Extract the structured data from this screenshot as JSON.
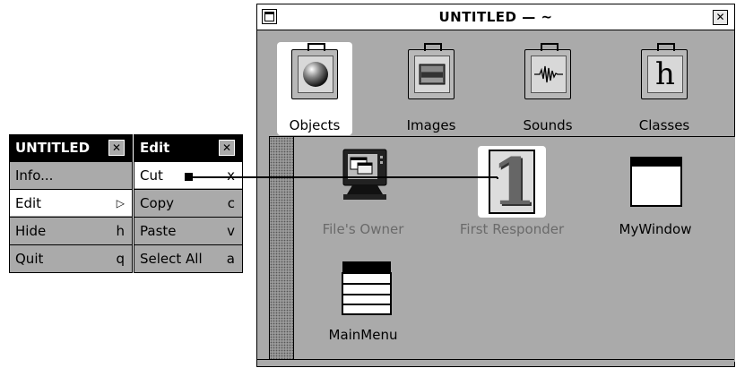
{
  "window": {
    "title": "UNTITLED — ~",
    "close_glyph": "✕",
    "suitcases": [
      {
        "label": "Objects",
        "icon": "sphere-icon",
        "selected": true
      },
      {
        "label": "Images",
        "icon": "image-icon",
        "selected": false
      },
      {
        "label": "Sounds",
        "icon": "waveform-icon",
        "selected": false
      },
      {
        "label": "Classes",
        "icon": "h-letter-icon",
        "glyph": "h",
        "selected": false
      }
    ],
    "objects": [
      {
        "label": "File's Owner",
        "icon": "computer-icon",
        "dimmed": true
      },
      {
        "label": "First Responder",
        "icon": "numeral-one-icon",
        "glyph": "1",
        "dimmed": true
      },
      {
        "label": "MyWindow",
        "icon": "window-icon",
        "dimmed": false
      },
      {
        "label": "MainMenu",
        "icon": "menu-icon",
        "dimmed": false
      }
    ]
  },
  "main_menu": {
    "title": "UNTITLED",
    "close_glyph": "✕",
    "items": [
      {
        "label": "Info...",
        "key": ""
      },
      {
        "label": "Edit",
        "key": "▷",
        "highlighted": true
      },
      {
        "label": "Hide",
        "key": "h"
      },
      {
        "label": "Quit",
        "key": "q"
      }
    ]
  },
  "edit_menu": {
    "title": "Edit",
    "close_glyph": "✕",
    "items": [
      {
        "label": "Cut",
        "key": "x",
        "highlighted": true
      },
      {
        "label": "Copy",
        "key": "c"
      },
      {
        "label": "Paste",
        "key": "v"
      },
      {
        "label": "Select All",
        "key": "a"
      }
    ]
  }
}
